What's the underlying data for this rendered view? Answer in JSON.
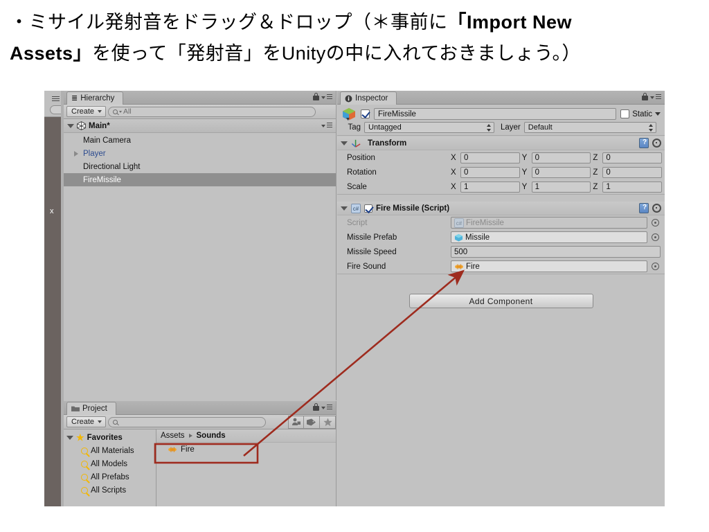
{
  "caption": {
    "line1_plain_a": "・ミサイル発射音をドラッグ＆ドロップ（＊事前に",
    "line1_bold": "「Import New",
    "line2_bold": "Assets」",
    "line2_plain": "を使って「発射音」をUnityの中に入れておきましょう。）"
  },
  "hierarchy": {
    "tab_label": "Hierarchy",
    "tab_icon": "hierarchy-list-icon",
    "create_label": "Create",
    "search_placeholder": "All",
    "scene_name": "Main*",
    "items": [
      {
        "label": "Main Camera",
        "selected": false,
        "prefab": false,
        "expandable": false
      },
      {
        "label": "Player",
        "selected": false,
        "prefab": true,
        "expandable": true
      },
      {
        "label": "Directional Light",
        "selected": false,
        "prefab": false,
        "expandable": false
      },
      {
        "label": "FireMissile",
        "selected": true,
        "prefab": false,
        "expandable": false
      }
    ]
  },
  "project": {
    "tab_label": "Project",
    "tab_icon": "folder-icon",
    "create_label": "Create",
    "search_placeholder": "",
    "toolbar_icons": [
      "object-filter-icon",
      "label-tag-icon",
      "favorite-star-icon"
    ],
    "favorites_label": "Favorites",
    "favorites": [
      {
        "label": "All Materials"
      },
      {
        "label": "All Models"
      },
      {
        "label": "All Prefabs"
      },
      {
        "label": "All Scripts"
      }
    ],
    "breadcrumb_root": "Assets",
    "breadcrumb_current": "Sounds",
    "assets": [
      {
        "label": "Fire",
        "icon": "audio-clip-icon",
        "highlighted": true
      }
    ]
  },
  "inspector": {
    "tab_label": "Inspector",
    "tab_icon": "info-circle-icon",
    "object_name": "FireMissile",
    "object_enabled": true,
    "static_label": "Static",
    "static_checked": false,
    "tag_label": "Tag",
    "tag_value": "Untagged",
    "layer_label": "Layer",
    "layer_value": "Default",
    "transform": {
      "title": "Transform",
      "rows": [
        {
          "label": "Position",
          "x": "0",
          "y": "0",
          "z": "0"
        },
        {
          "label": "Rotation",
          "x": "0",
          "y": "0",
          "z": "0"
        },
        {
          "label": "Scale",
          "x": "1",
          "y": "1",
          "z": "1"
        }
      ],
      "axis_x": "X",
      "axis_y": "Y",
      "axis_z": "Z"
    },
    "script_component": {
      "title": "Fire Missile (Script)",
      "enabled": true,
      "script_label": "Script",
      "script_value": "FireMissile",
      "prefab_label": "Missile Prefab",
      "prefab_value": "Missile",
      "speed_label": "Missile Speed",
      "speed_value": "500",
      "sound_label": "Fire Sound",
      "sound_value": "Fire"
    },
    "add_component_label": "Add Component"
  },
  "annotation": {
    "arrow_color": "#9e2b1e",
    "box_color": "#9e2b1e",
    "description": "drag-and-drop arrow from Fire audio asset to Fire Sound field"
  }
}
